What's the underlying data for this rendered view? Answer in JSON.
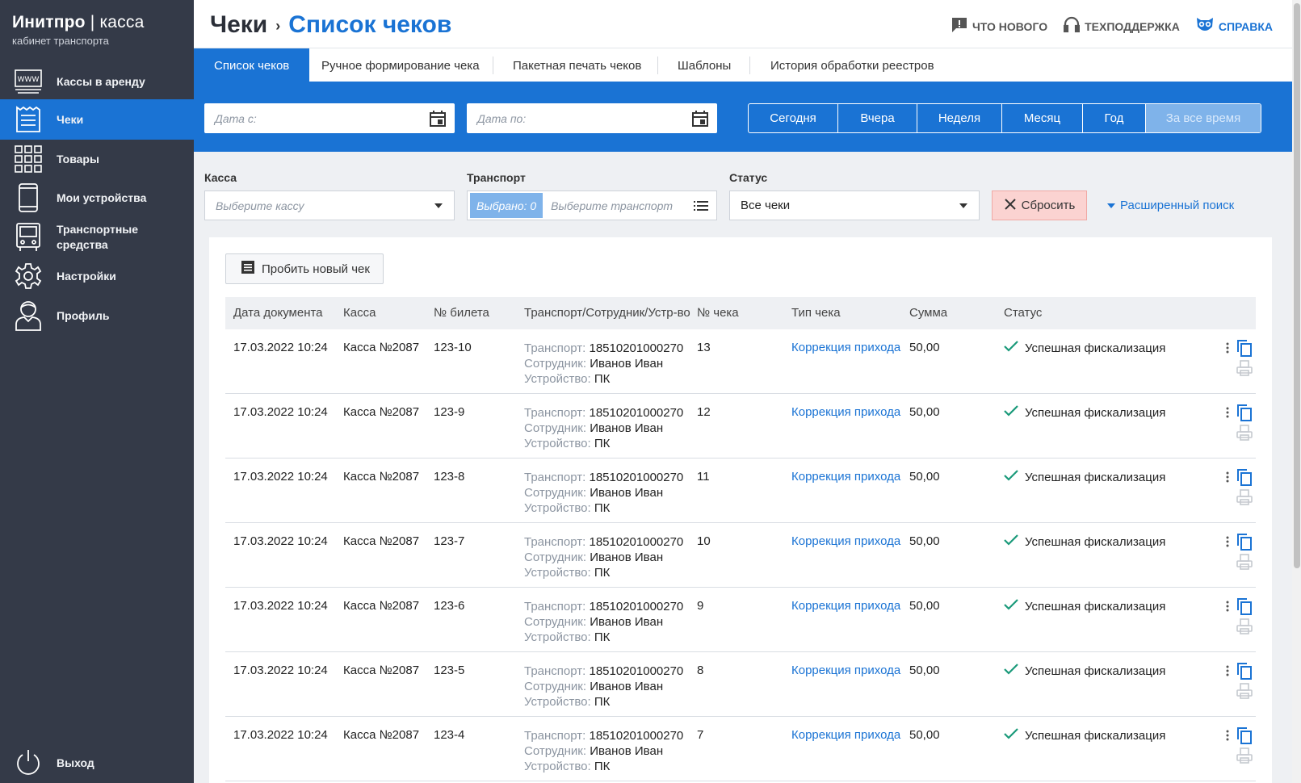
{
  "brand": {
    "title_bold": "Инитпро",
    "title_sep": " | ",
    "title_light": "касса",
    "subtitle": "кабинет транспорта"
  },
  "sidebar": {
    "items": [
      {
        "label": "Кассы в аренду",
        "icon": "www-icon",
        "active": false
      },
      {
        "label": "Чеки",
        "icon": "receipt-icon",
        "active": true
      },
      {
        "label": "Товары",
        "icon": "grid-icon",
        "active": false
      },
      {
        "label": "Мои устройства",
        "icon": "phone-icon",
        "active": false
      },
      {
        "label": "Транспортные средства",
        "icon": "bus-icon",
        "active": false
      },
      {
        "label": "Настройки",
        "icon": "gear-icon",
        "active": false
      },
      {
        "label": "Профиль",
        "icon": "user-icon",
        "active": false
      }
    ],
    "logout": "Выход"
  },
  "header": {
    "breadcrumb_parent": "Чеки",
    "breadcrumb_current": "Список чеков",
    "links": {
      "news": "Что нового",
      "support": "Техподдержка",
      "help": "Справка"
    }
  },
  "tabs": [
    "Список чеков",
    "Ручное формирование чека",
    "Пакетная печать чеков",
    "Шаблоны",
    "История обработки реестров"
  ],
  "date_filter": {
    "from_placeholder": "Дата с:",
    "to_placeholder": "Дата по:",
    "periods": [
      "Сегодня",
      "Вчера",
      "Неделя",
      "Месяц",
      "Год",
      "За все время"
    ],
    "selected_period": "За все время"
  },
  "filters": {
    "kassa_label": "Касса",
    "kassa_placeholder": "Выберите кассу",
    "transport_label": "Транспорт",
    "transport_chip": "Выбрано: 0",
    "transport_placeholder": "Выберите транспорт",
    "status_label": "Статус",
    "status_value": "Все чеки",
    "reset": "Сбросить",
    "advanced": "Расширенный поиск"
  },
  "table": {
    "new_button": "Пробить новый чек",
    "columns": [
      "Дата документа",
      "Касса",
      "№ билета",
      "Транспорт/Сотрудник/Устр-во",
      "№ чека",
      "Тип чека",
      "Сумма",
      "Статус"
    ],
    "labels": {
      "transport": "Транспорт:",
      "employee": "Сотрудник:",
      "device": "Устройство:"
    },
    "rows": [
      {
        "date": "17.03.2022 10:24",
        "kassa": "Касса №2087",
        "ticket": "123-10",
        "transport": "18510201000270",
        "employee": "Иванов Иван",
        "device": "ПК",
        "check_no": "13",
        "type": "Коррекция прихода",
        "sum": "50,00",
        "status": "Успешная фискализация"
      },
      {
        "date": "17.03.2022 10:24",
        "kassa": "Касса №2087",
        "ticket": "123-9",
        "transport": "18510201000270",
        "employee": "Иванов Иван",
        "device": "ПК",
        "check_no": "12",
        "type": "Коррекция прихода",
        "sum": "50,00",
        "status": "Успешная фискализация"
      },
      {
        "date": "17.03.2022 10:24",
        "kassa": "Касса №2087",
        "ticket": "123-8",
        "transport": "18510201000270",
        "employee": "Иванов Иван",
        "device": "ПК",
        "check_no": "11",
        "type": "Коррекция прихода",
        "sum": "50,00",
        "status": "Успешная фискализация"
      },
      {
        "date": "17.03.2022 10:24",
        "kassa": "Касса №2087",
        "ticket": "123-7",
        "transport": "18510201000270",
        "employee": "Иванов Иван",
        "device": "ПК",
        "check_no": "10",
        "type": "Коррекция прихода",
        "sum": "50,00",
        "status": "Успешная фискализация"
      },
      {
        "date": "17.03.2022 10:24",
        "kassa": "Касса №2087",
        "ticket": "123-6",
        "transport": "18510201000270",
        "employee": "Иванов Иван",
        "device": "ПК",
        "check_no": "9",
        "type": "Коррекция прихода",
        "sum": "50,00",
        "status": "Успешная фискализация"
      },
      {
        "date": "17.03.2022 10:24",
        "kassa": "Касса №2087",
        "ticket": "123-5",
        "transport": "18510201000270",
        "employee": "Иванов Иван",
        "device": "ПК",
        "check_no": "8",
        "type": "Коррекция прихода",
        "sum": "50,00",
        "status": "Успешная фискализация"
      },
      {
        "date": "17.03.2022 10:24",
        "kassa": "Касса №2087",
        "ticket": "123-4",
        "transport": "18510201000270",
        "employee": "Иванов Иван",
        "device": "ПК",
        "check_no": "7",
        "type": "Коррекция прихода",
        "sum": "50,00",
        "status": "Успешная фискализация"
      }
    ]
  },
  "colors": {
    "primary": "#1a73d4",
    "sidebar": "#343a48",
    "success": "#1a9a7a",
    "reset_bg": "#fbd3d1"
  }
}
